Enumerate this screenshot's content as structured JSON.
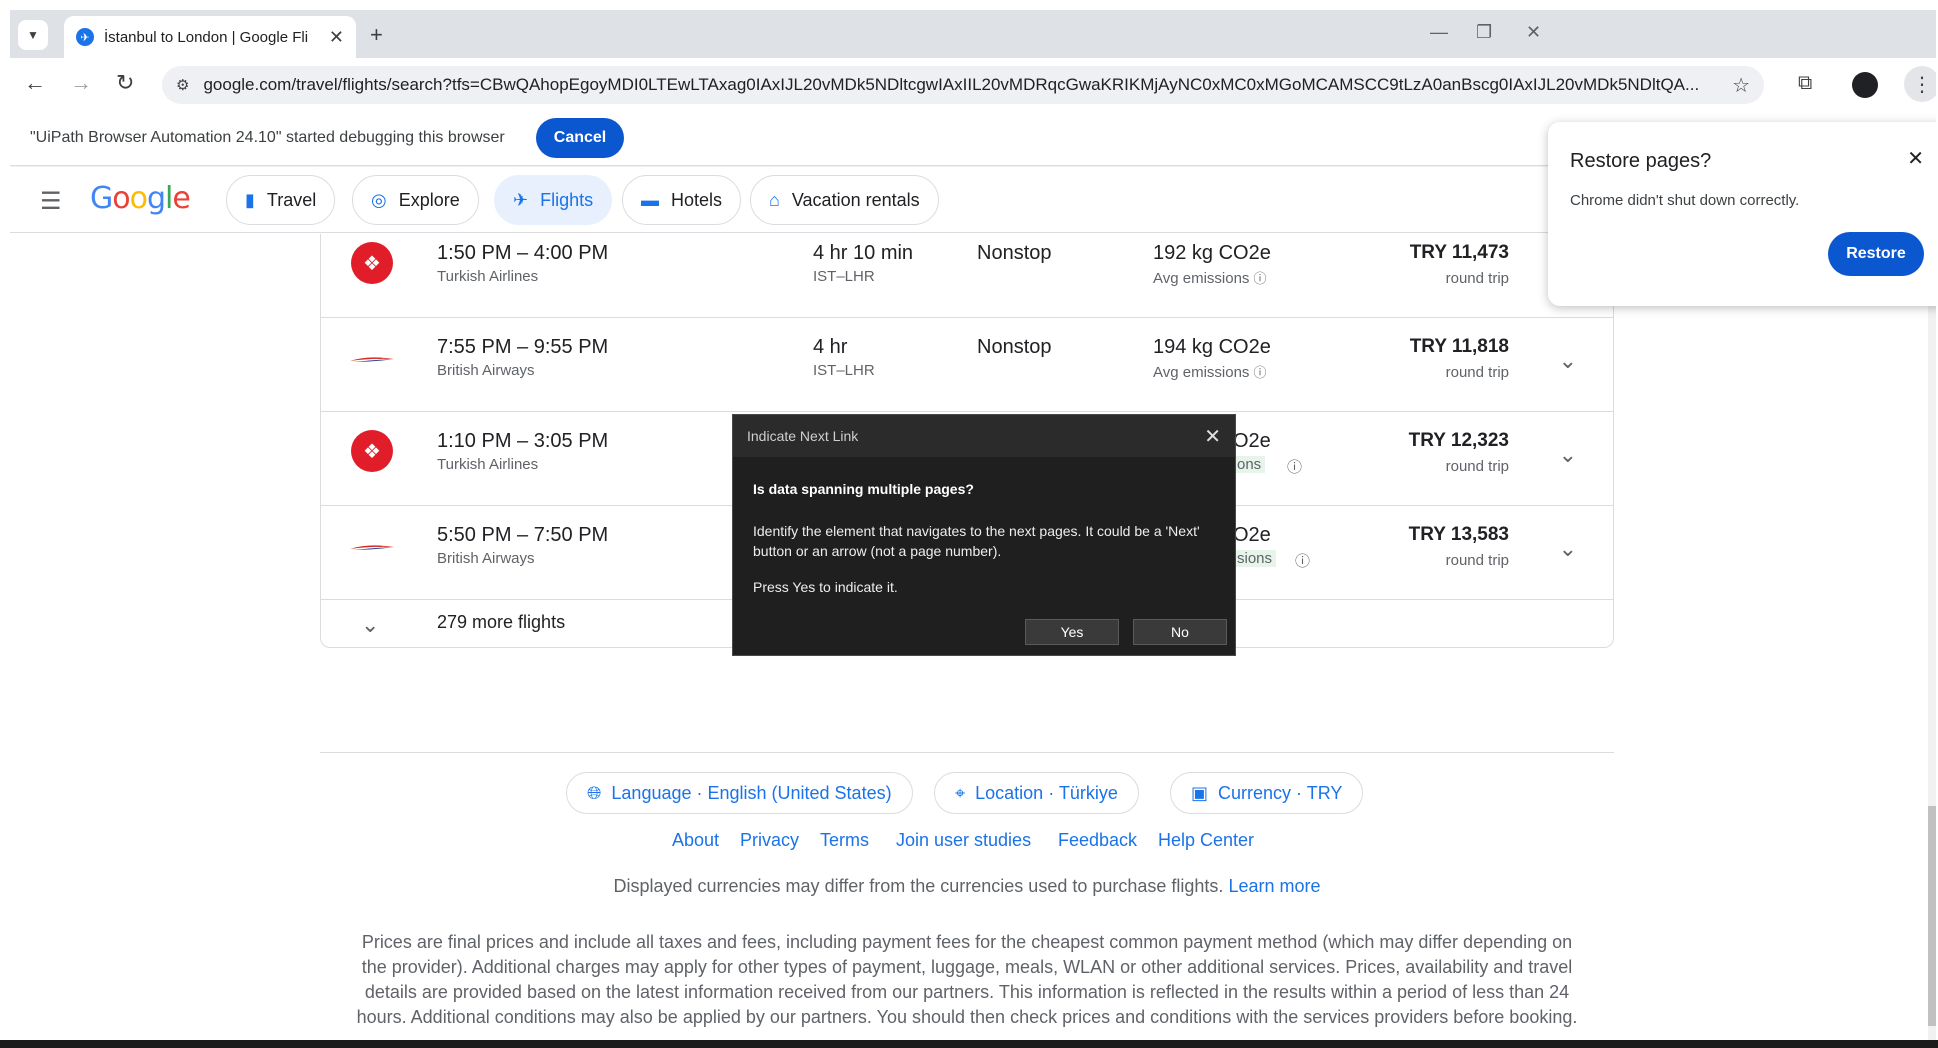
{
  "browser": {
    "tab_title": "İstanbul to London | Google Fli",
    "tab_close": "✕",
    "new_tab": "+",
    "url": "google.com/travel/flights/search?tfs=CBwQAhopEgoyMDI0LTEwLTAxag0IAxIJL20vMDk5NDltcgwIAxIIL20vMDRqcGwaKRIKMjAyNC0xMC0xMGoMCAMSCC9tLzA0anBscg0IAxIJL20vMDk5NDltQA...",
    "win_minimize": "—",
    "win_restore": "❐",
    "win_close": "✕"
  },
  "infobar": {
    "message": "\"UiPath Browser Automation 24.10\" started debugging this browser",
    "cancel_label": "Cancel"
  },
  "header": {
    "logo": "Google",
    "nav": [
      {
        "label": "Travel",
        "icon": "luggage-icon"
      },
      {
        "label": "Explore",
        "icon": "explore-icon"
      },
      {
        "label": "Flights",
        "icon": "plane-icon"
      },
      {
        "label": "Hotels",
        "icon": "bed-icon"
      },
      {
        "label": "Vacation rentals",
        "icon": "house-icon"
      }
    ]
  },
  "flights": [
    {
      "times": "1:50 PM – 4:00 PM",
      "airline": "Turkish Airlines",
      "duration": "4 hr 10 min",
      "route": "IST–LHR",
      "stops": "Nonstop",
      "emissions": "192 kg CO2e",
      "emissions_label": "Avg emissions",
      "price": "TRY 11,473",
      "trip": "round trip"
    },
    {
      "times": "7:55 PM – 9:55 PM",
      "airline": "British Airways",
      "duration": "4 hr",
      "route": "IST–LHR",
      "stops": "Nonstop",
      "emissions": "194 kg CO2e",
      "emissions_label": "Avg emissions",
      "price": "TRY 11,818",
      "trip": "round trip"
    },
    {
      "times": "1:10 PM – 3:05 PM",
      "airline": "Turkish Airlines",
      "duration": "",
      "route": "",
      "stops": "",
      "emissions": "O2e",
      "emissions_label": "ons",
      "price": "TRY 12,323",
      "trip": "round trip"
    },
    {
      "times": "5:50 PM – 7:50 PM",
      "airline": "British Airways",
      "duration": "",
      "route": "",
      "stops": "",
      "emissions": "O2e",
      "emissions_label": "sions",
      "price": "TRY 13,583",
      "trip": "round trip"
    }
  ],
  "more_flights": "279 more flights",
  "footer": {
    "language": "Language · English (United States)",
    "location": "Location · Türkiye",
    "currency": "Currency · TRY",
    "links": [
      "About",
      "Privacy",
      "Terms",
      "Join user studies",
      "Feedback",
      "Help Center"
    ],
    "currency_note": "Displayed currencies may differ from the currencies used to purchase flights.",
    "learn_more": "Learn more",
    "disclaimer": "Prices are final prices and include all taxes and fees, including payment fees for the cheapest common payment method (which may differ depending on the provider). Additional charges may apply for other types of payment, luggage, meals, WLAN or other additional services. Prices, availability and travel details are provided based on the latest information received from our partners. This information is reflected in the results within a period of less than 24 hours. Additional conditions may also be applied by our partners. You should then check prices and conditions with the services providers before booking."
  },
  "uipath_dialog": {
    "title": "Indicate Next Link",
    "question": "Is data spanning multiple pages?",
    "description": "Identify the element that navigates to the next pages. It could be a 'Next' button or an arrow (not a page number).",
    "prompt": "Press Yes to indicate it.",
    "yes_label": "Yes",
    "no_label": "No"
  },
  "restore_popup": {
    "title": "Restore pages?",
    "subtitle": "Chrome didn't shut down correctly.",
    "button": "Restore"
  },
  "colors": {
    "accent": "#1a73e8",
    "button_blue": "#0b57d0",
    "turkish_red": "#e11d2a",
    "ba_red": "#d52b1e",
    "ba_blue": "#1e3a8a"
  }
}
